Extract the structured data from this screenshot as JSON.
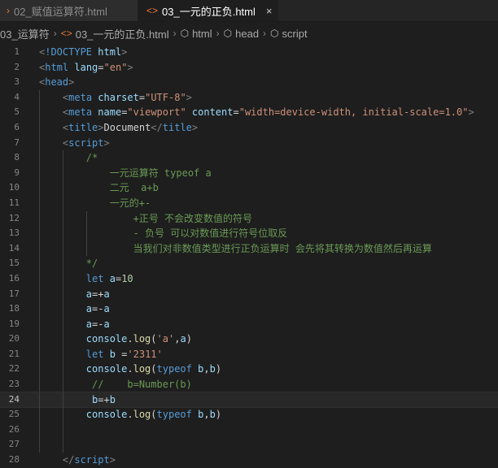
{
  "tabs": [
    {
      "label": "02_赋值运算符.html",
      "icon": "html-file-icon",
      "active": false
    },
    {
      "label": "03_一元的正负.html",
      "icon": "html-file-icon",
      "active": true,
      "close": "×"
    }
  ],
  "breadcrumb": [
    {
      "label": "03_运算符",
      "icon": "folder"
    },
    {
      "label": "03_一元的正负.html",
      "icon": "html-file-icon"
    },
    {
      "label": "html",
      "icon": "symbol-icon"
    },
    {
      "label": "head",
      "icon": "symbol-icon"
    },
    {
      "label": "script",
      "icon": "symbol-icon"
    }
  ],
  "editor": {
    "current_line": 24,
    "lines": [
      [
        [
          "punct",
          "<"
        ],
        [
          "kw",
          "!DOCTYPE"
        ],
        [
          "txt",
          " "
        ],
        [
          "attr",
          "html"
        ],
        [
          "punct",
          ">"
        ]
      ],
      [
        [
          "punct",
          "<"
        ],
        [
          "tag",
          "html"
        ],
        [
          "txt",
          " "
        ],
        [
          "attr",
          "lang"
        ],
        [
          "txt",
          "="
        ],
        [
          "str",
          "\"en\""
        ],
        [
          "punct",
          ">"
        ]
      ],
      [
        [
          "punct",
          "<"
        ],
        [
          "tag",
          "head"
        ],
        [
          "punct",
          ">"
        ]
      ],
      [
        [
          "txt",
          "    "
        ],
        [
          "punct",
          "<"
        ],
        [
          "tag",
          "meta"
        ],
        [
          "txt",
          " "
        ],
        [
          "attr",
          "charset"
        ],
        [
          "txt",
          "="
        ],
        [
          "str",
          "\"UTF-8\""
        ],
        [
          "punct",
          ">"
        ]
      ],
      [
        [
          "txt",
          "    "
        ],
        [
          "punct",
          "<"
        ],
        [
          "tag",
          "meta"
        ],
        [
          "txt",
          " "
        ],
        [
          "attr",
          "name"
        ],
        [
          "txt",
          "="
        ],
        [
          "str",
          "\"viewport\""
        ],
        [
          "txt",
          " "
        ],
        [
          "attr",
          "content"
        ],
        [
          "txt",
          "="
        ],
        [
          "str",
          "\"width=device-width, initial-scale=1.0\""
        ],
        [
          "punct",
          ">"
        ]
      ],
      [
        [
          "txt",
          "    "
        ],
        [
          "punct",
          "<"
        ],
        [
          "tag",
          "title"
        ],
        [
          "punct",
          ">"
        ],
        [
          "txt",
          "Document"
        ],
        [
          "punct",
          "</"
        ],
        [
          "tag",
          "title"
        ],
        [
          "punct",
          ">"
        ]
      ],
      [
        [
          "txt",
          "    "
        ],
        [
          "punct",
          "<"
        ],
        [
          "tag",
          "script"
        ],
        [
          "punct",
          ">"
        ]
      ],
      [
        [
          "cmt",
          "        /*"
        ]
      ],
      [
        [
          "cmt",
          "            一元运算符 typeof a"
        ]
      ],
      [
        [
          "cmt",
          "            二元  a+b"
        ]
      ],
      [
        [
          "cmt",
          "            一元的+-"
        ]
      ],
      [
        [
          "cmt",
          "                +正号 不会改变数值的符号"
        ]
      ],
      [
        [
          "cmt",
          "                - 负号 可以对数值进行符号位取反"
        ]
      ],
      [
        [
          "cmt",
          "                当我们对非数值类型进行正负运算时 会先将其转换为数值然后再运算"
        ]
      ],
      [
        [
          "cmt",
          "        */"
        ]
      ],
      [
        [
          "txt",
          "        "
        ],
        [
          "kw",
          "let"
        ],
        [
          "txt",
          " "
        ],
        [
          "var",
          "a"
        ],
        [
          "txt",
          "="
        ],
        [
          "num",
          "10"
        ]
      ],
      [
        [
          "txt",
          "        "
        ],
        [
          "var",
          "a"
        ],
        [
          "txt",
          "=+"
        ],
        [
          "var",
          "a"
        ]
      ],
      [
        [
          "txt",
          "        "
        ],
        [
          "var",
          "a"
        ],
        [
          "txt",
          "=-"
        ],
        [
          "var",
          "a"
        ]
      ],
      [
        [
          "txt",
          "        "
        ],
        [
          "var",
          "a"
        ],
        [
          "txt",
          "=-"
        ],
        [
          "var",
          "a"
        ]
      ],
      [
        [
          "txt",
          "        "
        ],
        [
          "var",
          "console"
        ],
        [
          "txt",
          "."
        ],
        [
          "fn",
          "log"
        ],
        [
          "txt",
          "("
        ],
        [
          "str",
          "'a'"
        ],
        [
          "txt",
          ","
        ],
        [
          "var",
          "a"
        ],
        [
          "txt",
          ")"
        ]
      ],
      [
        [
          "txt",
          "        "
        ],
        [
          "kw",
          "let"
        ],
        [
          "txt",
          " "
        ],
        [
          "var",
          "b"
        ],
        [
          "txt",
          " ="
        ],
        [
          "str",
          "'2311'"
        ]
      ],
      [
        [
          "txt",
          "        "
        ],
        [
          "var",
          "console"
        ],
        [
          "txt",
          "."
        ],
        [
          "fn",
          "log"
        ],
        [
          "txt",
          "("
        ],
        [
          "kw",
          "typeof"
        ],
        [
          "txt",
          " "
        ],
        [
          "var",
          "b"
        ],
        [
          "txt",
          ","
        ],
        [
          "var",
          "b"
        ],
        [
          "txt",
          ")"
        ]
      ],
      [
        [
          "cmt",
          "         //    b=Number(b)"
        ]
      ],
      [
        [
          "txt",
          "         "
        ],
        [
          "var",
          "b"
        ],
        [
          "txt",
          "=+"
        ],
        [
          "var",
          "b"
        ]
      ],
      [
        [
          "txt",
          "        "
        ],
        [
          "var",
          "console"
        ],
        [
          "txt",
          "."
        ],
        [
          "fn",
          "log"
        ],
        [
          "txt",
          "("
        ],
        [
          "kw",
          "typeof"
        ],
        [
          "txt",
          " "
        ],
        [
          "var",
          "b"
        ],
        [
          "txt",
          ","
        ],
        [
          "var",
          "b"
        ],
        [
          "txt",
          ")"
        ]
      ],
      [],
      [],
      [
        [
          "txt",
          "    "
        ],
        [
          "punct",
          "</"
        ],
        [
          "tag",
          "script"
        ],
        [
          "punct",
          ">"
        ]
      ]
    ]
  }
}
